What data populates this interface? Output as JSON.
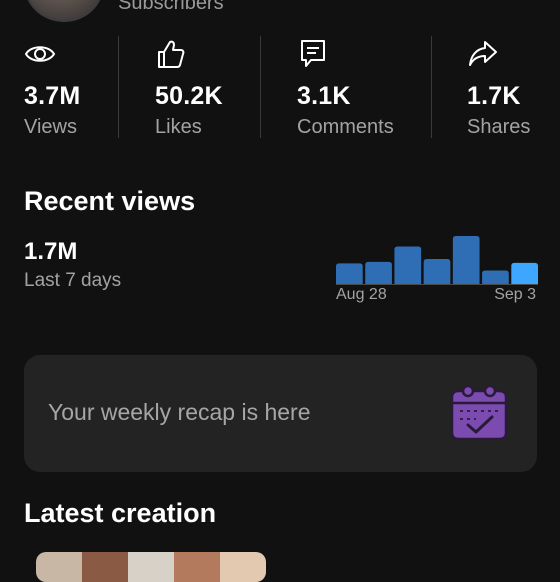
{
  "header": {
    "subscribers_label": "Subscribers"
  },
  "stats": [
    {
      "icon": "eye-icon",
      "value": "3.7M",
      "label": "Views"
    },
    {
      "icon": "thumbs-up-icon",
      "value": "50.2K",
      "label": "Likes"
    },
    {
      "icon": "comment-icon",
      "value": "3.1K",
      "label": "Comments"
    },
    {
      "icon": "share-icon",
      "value": "1.7K",
      "label": "Shares"
    }
  ],
  "recent_views": {
    "title": "Recent views",
    "value": "1.7M",
    "period": "Last 7 days",
    "start_date": "Aug 28",
    "end_date": "Sep 3"
  },
  "chart_data": {
    "type": "bar",
    "categories": [
      "Aug 28",
      "",
      "",
      "",
      "",
      "",
      "Sep 3"
    ],
    "values": [
      0.43,
      0.46,
      0.78,
      0.52,
      1.0,
      0.28,
      0.44
    ],
    "colors": [
      "#2f6db5",
      "#2f6db5",
      "#2f6db5",
      "#2f6db5",
      "#2f6db5",
      "#2f6db5",
      "#3ea6ff"
    ],
    "xlabel": "",
    "ylabel": ""
  },
  "recap": {
    "text": "Your weekly recap is here",
    "icon": "calendar-check-icon"
  },
  "latest": {
    "title": "Latest creation"
  },
  "colors": {
    "background": "#111111",
    "card": "#232323",
    "bar": "#2f6db5",
    "bar_highlight": "#3ea6ff",
    "recap_icon": "#7b4bb0"
  }
}
